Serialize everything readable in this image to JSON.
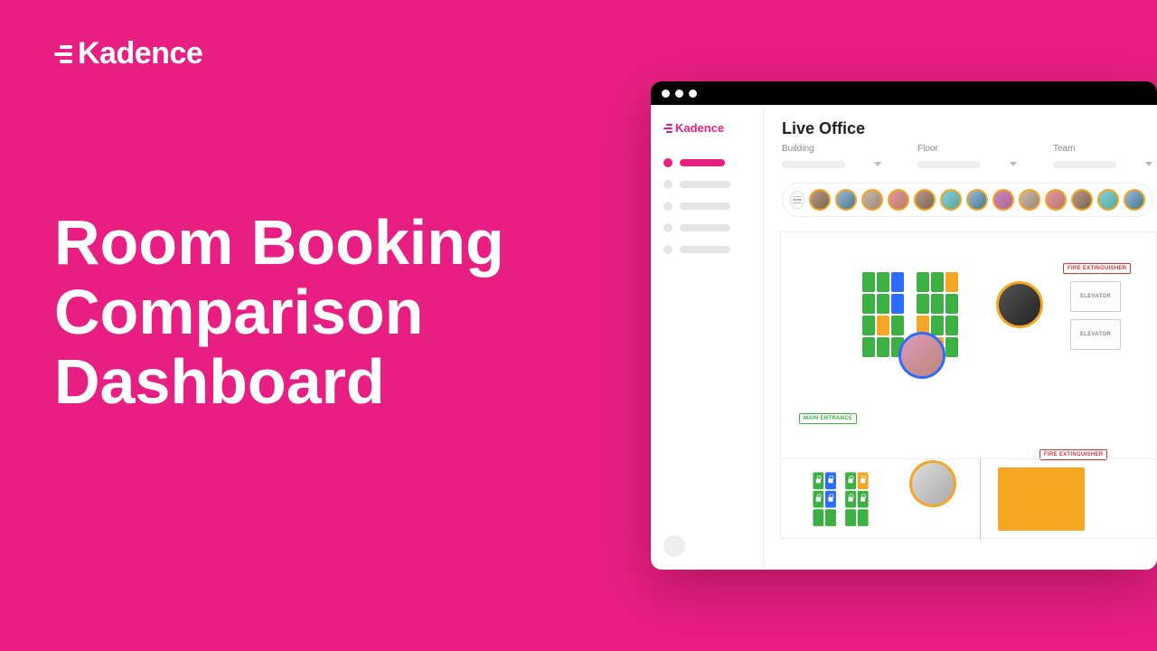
{
  "brand": "Kadence",
  "headline": "Room Booking Comparison Dashboard",
  "app": {
    "brand": "Kadence",
    "page_title": "Live Office",
    "filters": {
      "building": "Building",
      "floor": "Floor",
      "team": "Team"
    },
    "labels": {
      "fire": "FIRE EXTINGUISHER",
      "elevator": "ELEVATOR",
      "main_entrance": "MAIN ENTRANCE"
    }
  }
}
